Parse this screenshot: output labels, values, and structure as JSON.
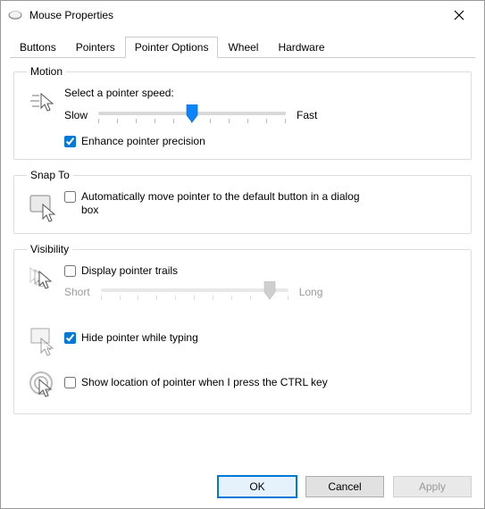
{
  "title": "Mouse Properties",
  "tabs": [
    "Buttons",
    "Pointers",
    "Pointer Options",
    "Wheel",
    "Hardware"
  ],
  "active_tab": "Pointer Options",
  "motion": {
    "legend": "Motion",
    "label": "Select a pointer speed:",
    "slow": "Slow",
    "fast": "Fast",
    "speed_value": 6,
    "speed_min": 1,
    "speed_max": 11,
    "enhance_label": "Enhance pointer precision",
    "enhance_checked": true
  },
  "snap": {
    "legend": "Snap To",
    "auto_label": "Automatically move pointer to the default button in a dialog box",
    "auto_checked": false
  },
  "visibility": {
    "legend": "Visibility",
    "trails_label": "Display pointer trails",
    "trails_checked": false,
    "short": "Short",
    "long": "Long",
    "trails_value": 10,
    "trails_min": 1,
    "trails_max": 11,
    "trails_enabled": false,
    "hide_label": "Hide pointer while typing",
    "hide_checked": true,
    "ctrl_label": "Show location of pointer when I press the CTRL key",
    "ctrl_checked": false
  },
  "buttons": {
    "ok": "OK",
    "cancel": "Cancel",
    "apply": "Apply"
  }
}
